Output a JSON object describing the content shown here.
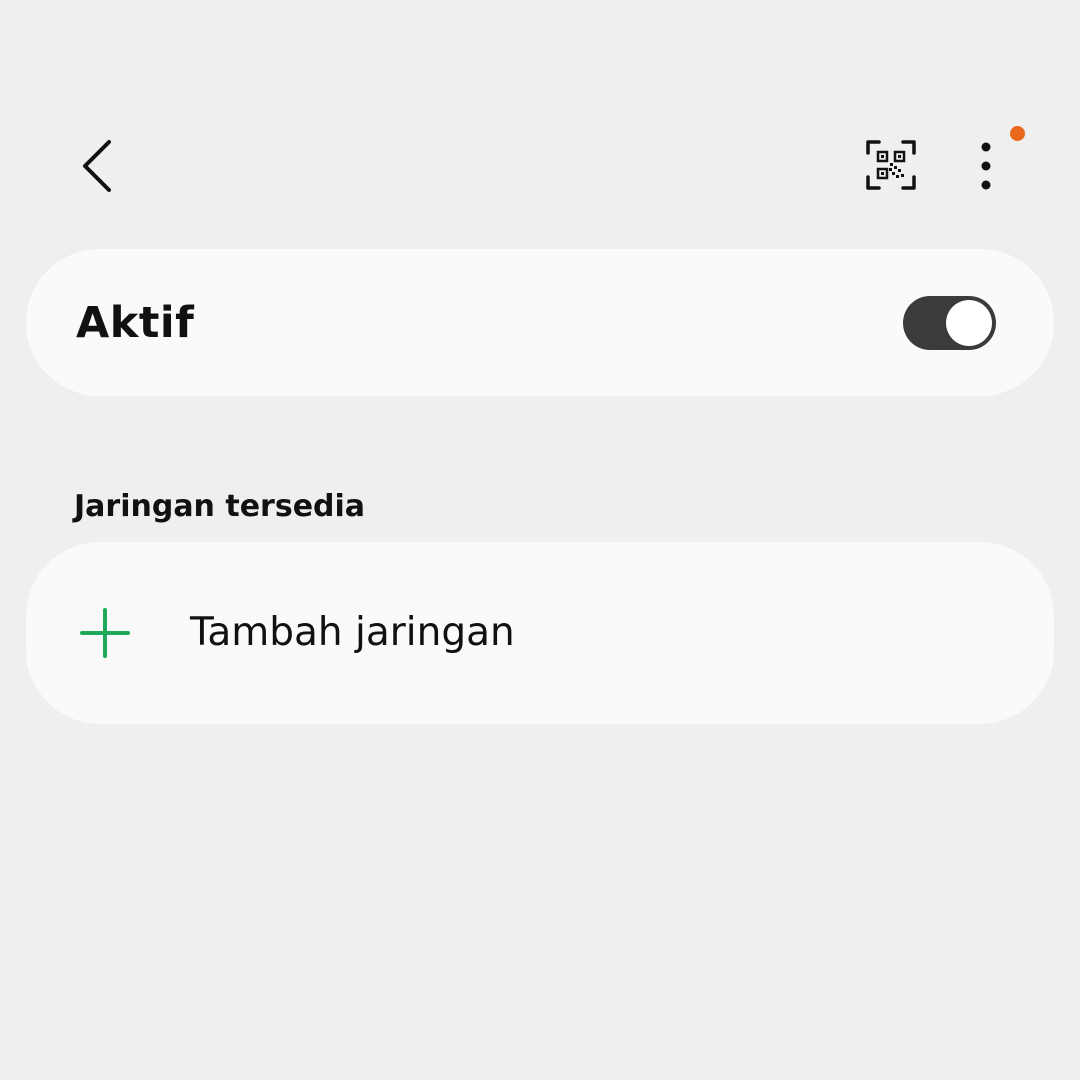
{
  "header": {
    "back_icon": "chevron-left-icon",
    "qr_icon": "qr-scan-icon",
    "more_icon": "more-vertical-icon",
    "notification_dot_color": "#e8691c"
  },
  "toggle": {
    "label": "Aktif",
    "state": "on",
    "track_color": "#3b3b3b",
    "knob_color": "#ffffff"
  },
  "networks": {
    "section_title": "Jaringan tersedia",
    "add_label": "Tambah jaringan",
    "add_icon": "plus-icon",
    "add_icon_color": "#1fa85a"
  }
}
